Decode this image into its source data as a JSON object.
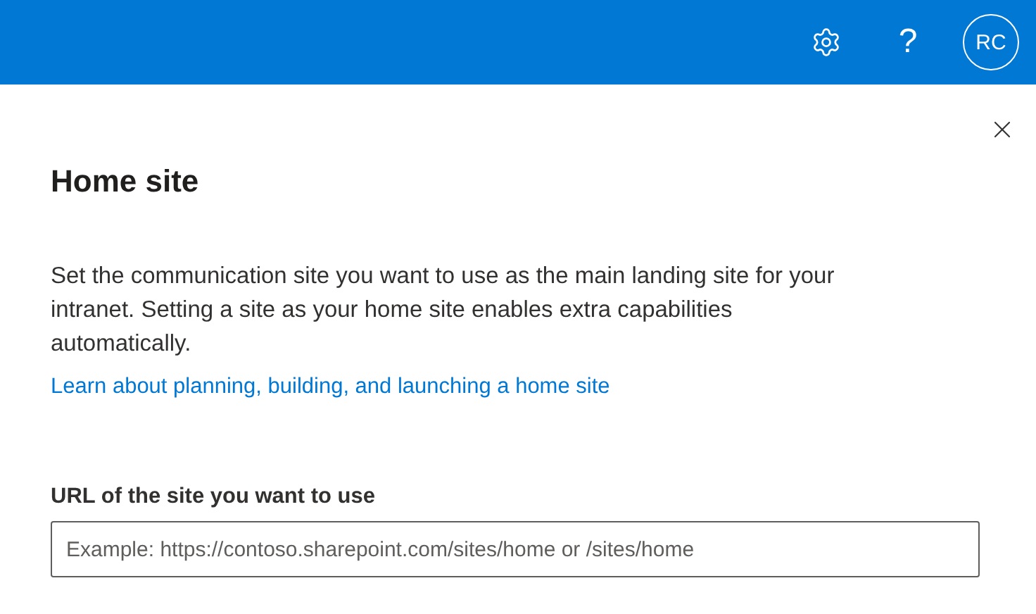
{
  "top_bar": {
    "help": "?",
    "avatar": "RC"
  },
  "panel": {
    "title": "Home site",
    "description": "Set the communication site you want to use as the main landing site for your intranet. Setting a site as your home site enables extra capabilities automatically.",
    "link": "Learn about planning, building, and launching a home site",
    "field": {
      "label": "URL of the site you want to use",
      "placeholder": "Example: https://contoso.sharepoint.com/sites/home or /sites/home"
    }
  }
}
